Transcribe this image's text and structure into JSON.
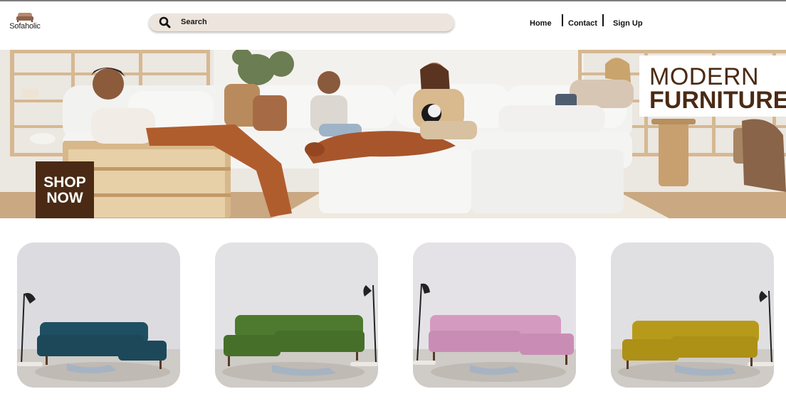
{
  "header": {
    "logo_text": "Sofaholic",
    "search": {
      "label": "Search"
    },
    "nav": [
      {
        "label": "Home"
      },
      {
        "label": "Contact"
      },
      {
        "label": "Sign Up"
      }
    ]
  },
  "hero": {
    "title_line1": "MODERN",
    "title_line2": "FURNITURE",
    "cta_line1": "SHOP",
    "cta_line2": "NOW"
  },
  "colors": {
    "brand_brown": "#4a2a14",
    "search_bg": "#ede5dd",
    "sofa_colors": [
      "#1f4f63",
      "#4d7a2e",
      "#d49ac0",
      "#b89a1a"
    ]
  },
  "products": [
    {
      "name": "teal-velvet-sectional",
      "color": "#1f4f63"
    },
    {
      "name": "green-velvet-sectional",
      "color": "#4d7a2e"
    },
    {
      "name": "pink-velvet-sectional",
      "color": "#d49ac0"
    },
    {
      "name": "mustard-velvet-sectional",
      "color": "#b89a1a"
    }
  ]
}
